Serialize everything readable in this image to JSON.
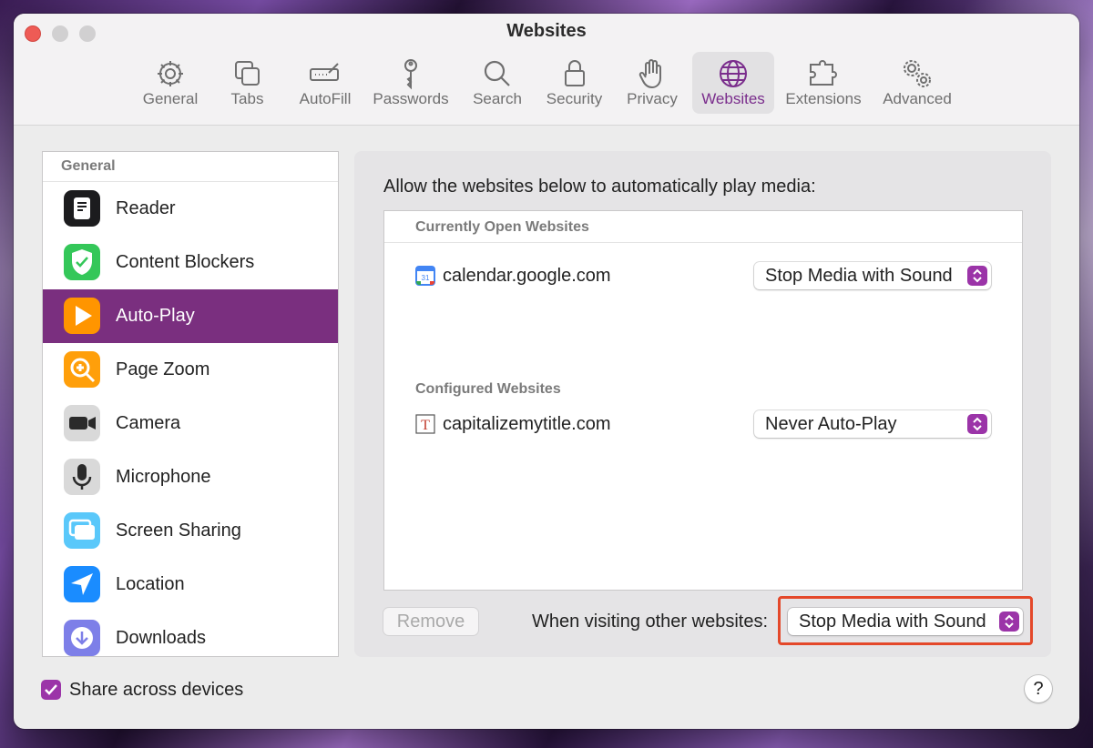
{
  "window": {
    "title": "Websites"
  },
  "toolbar": {
    "items": [
      {
        "label": "General",
        "icon": "gear-icon"
      },
      {
        "label": "Tabs",
        "icon": "tabs-icon"
      },
      {
        "label": "AutoFill",
        "icon": "autofill-icon"
      },
      {
        "label": "Passwords",
        "icon": "key-icon"
      },
      {
        "label": "Search",
        "icon": "magnifier-icon"
      },
      {
        "label": "Security",
        "icon": "lock-icon"
      },
      {
        "label": "Privacy",
        "icon": "hand-icon"
      },
      {
        "label": "Websites",
        "icon": "globe-icon",
        "active": true
      },
      {
        "label": "Extensions",
        "icon": "puzzle-icon"
      },
      {
        "label": "Advanced",
        "icon": "gears-icon"
      }
    ]
  },
  "sidebar": {
    "header": "General",
    "items": [
      {
        "label": "Reader",
        "icon": "reader-icon"
      },
      {
        "label": "Content Blockers",
        "icon": "shield-check-icon"
      },
      {
        "label": "Auto-Play",
        "icon": "play-icon",
        "selected": true
      },
      {
        "label": "Page Zoom",
        "icon": "zoom-icon"
      },
      {
        "label": "Camera",
        "icon": "camera-icon"
      },
      {
        "label": "Microphone",
        "icon": "microphone-icon"
      },
      {
        "label": "Screen Sharing",
        "icon": "screen-sharing-icon"
      },
      {
        "label": "Location",
        "icon": "location-arrow-icon"
      },
      {
        "label": "Downloads",
        "icon": "download-icon"
      }
    ]
  },
  "panel": {
    "description": "Allow the websites below to automatically play media:",
    "open_header": "Currently Open Websites",
    "open_sites": [
      {
        "name": "calendar.google.com",
        "setting": "Stop Media with Sound",
        "icon_text": "31"
      }
    ],
    "configured_header": "Configured Websites",
    "configured_sites": [
      {
        "name": "capitalizemytitle.com",
        "setting": "Never Auto-Play",
        "icon_text": "T"
      }
    ],
    "remove_label": "Remove",
    "other_label": "When visiting other websites:",
    "other_setting": "Stop Media with Sound"
  },
  "footer": {
    "share_label": "Share across devices",
    "share_checked": true,
    "help_label": "?"
  },
  "colors": {
    "accent": "#9b34a8",
    "selection": "#7a2f7f",
    "highlight_box": "#e4482a"
  }
}
